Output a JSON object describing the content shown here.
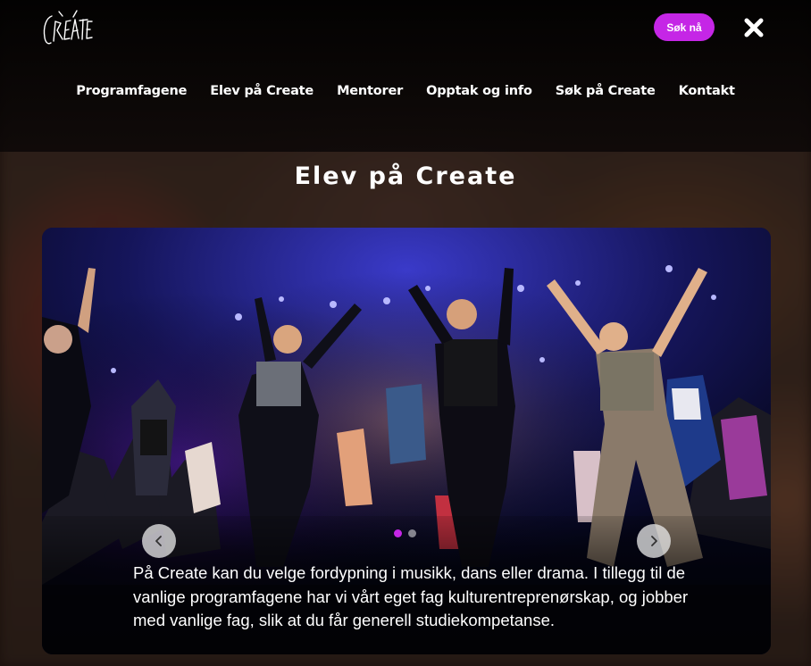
{
  "header": {
    "logo_text": "CREATE",
    "cta_label": "Søk nå",
    "close_icon": "close-x-icon"
  },
  "nav": {
    "items": [
      {
        "label": "Programfagene"
      },
      {
        "label": "Elev på Create"
      },
      {
        "label": "Mentorer"
      },
      {
        "label": "Opptak og info"
      },
      {
        "label": "Søk på Create"
      },
      {
        "label": "Kontakt"
      }
    ]
  },
  "page": {
    "title": "Elev på Create"
  },
  "carousel": {
    "caption": "På Create kan du velge fordypning i musikk, dans eller drama. I tillegg til de vanlige programfagene har vi vårt eget fag kulturentreprenørskap, og jobber med vanlige fag, slik at du får generell studiekompetanse.",
    "prev_icon": "chevron-left-icon",
    "next_icon": "chevron-right-icon",
    "slide_count": 2,
    "active_slide": 1
  },
  "colors": {
    "accent": "#c526e6",
    "header_bg": "#000000",
    "text": "#ffffff"
  }
}
